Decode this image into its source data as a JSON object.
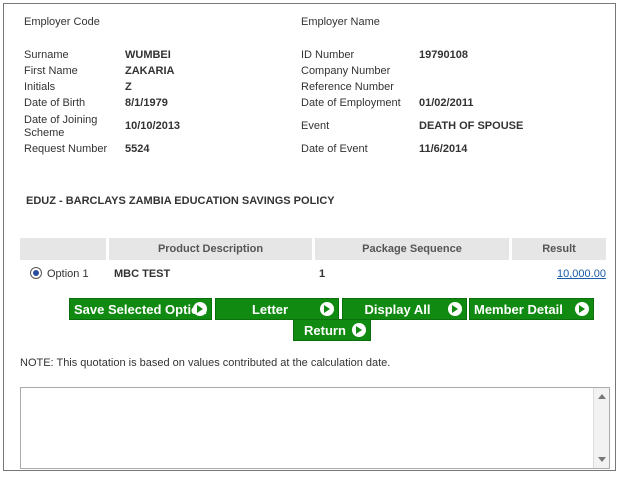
{
  "employer": {
    "code_label": "Employer Code",
    "name_label": "Employer Name"
  },
  "left_fields": [
    {
      "label": "Surname",
      "value": "WUMBEI"
    },
    {
      "label": "First Name",
      "value": "ZAKARIA"
    },
    {
      "label": "Initials",
      "value": "Z"
    },
    {
      "label": "Date of Birth",
      "value": "8/1/1979"
    },
    {
      "label": "Date of Joining Scheme",
      "value": "10/10/2013"
    },
    {
      "label": "Request Number",
      "value": "5524"
    }
  ],
  "right_fields": [
    {
      "label": "ID Number",
      "value": "19790108"
    },
    {
      "label": "Company Number",
      "value": ""
    },
    {
      "label": "Reference Number",
      "value": ""
    },
    {
      "label": "Date of Employment",
      "value": "01/02/2011"
    },
    {
      "label": "Event",
      "value": "DEATH OF SPOUSE"
    },
    {
      "label": "Date of Event",
      "value": "11/6/2014"
    }
  ],
  "policy_title": "EDUZ - BARCLAYS ZAMBIA EDUCATION SAVINGS POLICY",
  "table": {
    "headers": [
      "Product Description",
      "Package Sequence",
      "Result"
    ],
    "rows": [
      {
        "option": "Option 1",
        "product": "MBC TEST",
        "sequence": "1",
        "result": "10,000.00",
        "selected": true
      }
    ]
  },
  "buttons": {
    "save_selected": "Save Selected Option",
    "letter": "Letter",
    "display_all": "Display All",
    "member_detail": "Member Detail",
    "return": "Return"
  },
  "note": "NOTE: This quotation is based on values contributed at the calculation date.",
  "colors": {
    "button_green": "#118a11",
    "link_blue": "#1b5ba8",
    "header_gray": "#e6e6e6"
  }
}
